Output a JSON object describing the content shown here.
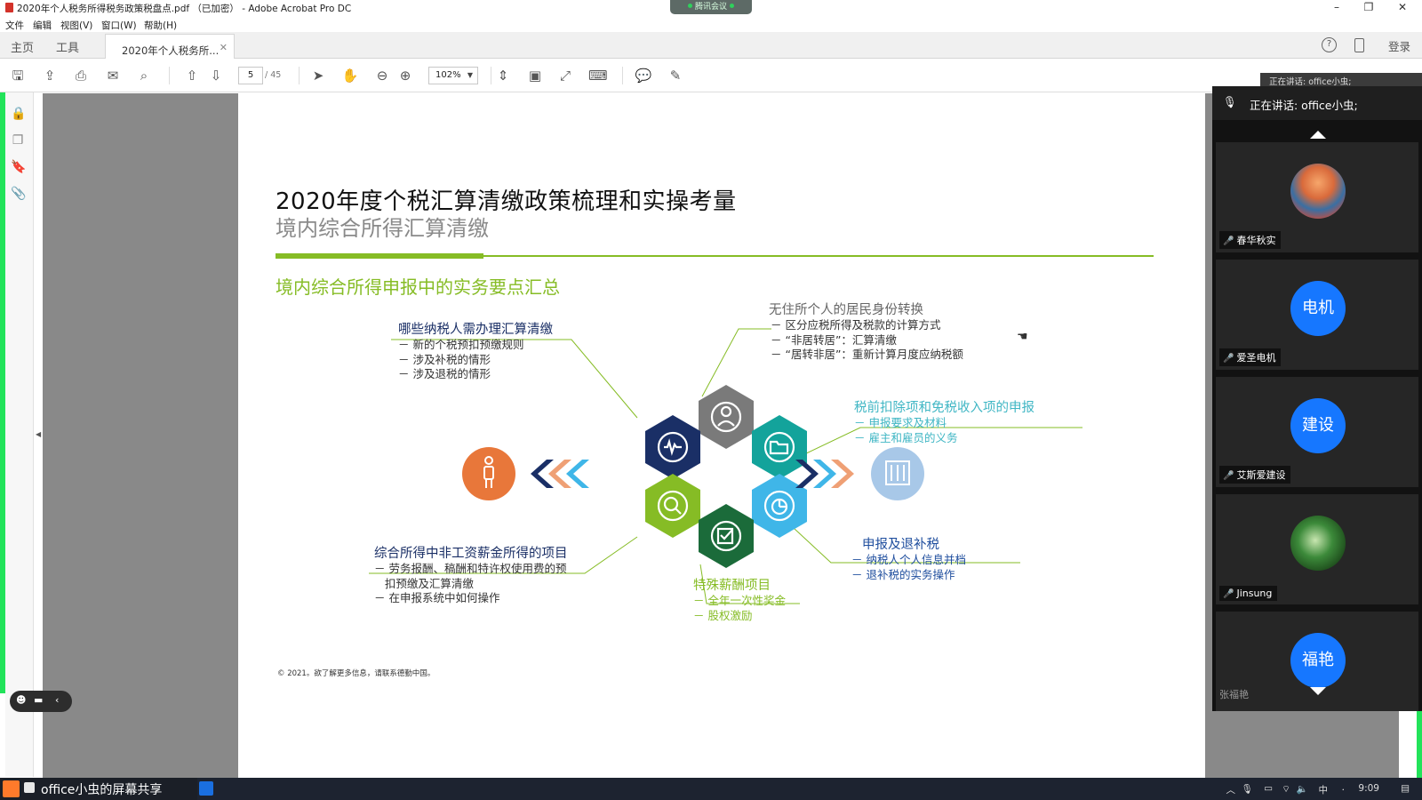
{
  "window": {
    "title": "2020年个人税务所得税务政策税盘点.pdf （已加密） - Adobe Acrobat Pro DC",
    "meeting_pill": "腾讯会议"
  },
  "menu": [
    "文件",
    "编辑",
    "视图(V)",
    "窗口(W)",
    "帮助(H)"
  ],
  "tabs": {
    "home": "主页",
    "tools": "工具",
    "document": "2020年个人税务所...",
    "login": "登录"
  },
  "toolbar": {
    "page_current": "5",
    "page_total": "/ 45",
    "zoom": "102%"
  },
  "slide": {
    "title": "2020年度个税汇算清缴政策梳理和实操考量",
    "subtitle": "境内综合所得汇算清缴",
    "section": "境内综合所得申报中的实务要点汇总",
    "block_top_left": {
      "heading": "哪些纳税人需办理汇算清缴",
      "items": [
        "－ 新的个税预扣预缴规则",
        "－ 涉及补税的情形",
        "－ 涉及退税的情形"
      ]
    },
    "block_top_right": {
      "heading": "无住所个人的居民身份转换",
      "items": [
        "－ 区分应税所得及税款的计算方式",
        "－ “非居转居”：汇算清缴",
        "－ “居转非居”：重新计算月度应纳税额"
      ]
    },
    "block_mid_right": {
      "heading": "税前扣除项和免税收入项的申报",
      "items": [
        "－ 申报要求及材料",
        "－ 雇主和雇员的义务"
      ]
    },
    "block_bottom_right": {
      "heading": "申报及退补税",
      "items": [
        "－ 纳税人个人信息并档",
        "－ 退补税的实务操作"
      ]
    },
    "block_bottom_left": {
      "heading": "综合所得中非工资薪金所得的项目",
      "items": [
        "－ 劳务报酬、稿酬和特许权使用费的预",
        "   扣预缴及汇算清缴",
        "－ 在申报系统中如何操作"
      ]
    },
    "block_bottom_center": {
      "heading": "特殊薪酬项目",
      "items": [
        "－ 全年一次性奖金",
        "－ 股权激励"
      ]
    },
    "copyright": "© 2021。欲了解更多信息，请联系德勤中国。",
    "colors": {
      "green": "#86bc25",
      "navy": "#1a2f66",
      "teal": "#3fb6c4",
      "orange": "#e8773a",
      "grey": "#7a7a7a"
    }
  },
  "meeting": {
    "speaking_tip": "正在讲话: office小虫;",
    "speaking": "正在讲话: office小虫;",
    "participants": [
      {
        "name": "春华秋实",
        "avatar_text": "",
        "style": "img1"
      },
      {
        "name": "爱圣电机",
        "avatar_text": "电机",
        "style": ""
      },
      {
        "name": "艾斯爱建设",
        "avatar_text": "建设",
        "style": ""
      },
      {
        "name": "Jinsung",
        "avatar_text": "",
        "style": "img2"
      },
      {
        "name": "张福艳",
        "avatar_text": "福艳",
        "style": ""
      }
    ]
  },
  "taskbar": {
    "share_label": "office小虫的屏幕共享",
    "ime": "中",
    "time": "9:09"
  }
}
